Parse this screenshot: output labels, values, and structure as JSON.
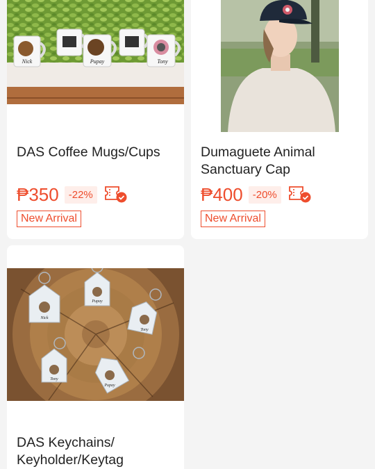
{
  "products": [
    {
      "title": "DAS Coffee Mugs/Cups",
      "price": "₱350",
      "discount": "-22%",
      "tag": "New Arrival",
      "mug_names": [
        "Nick",
        "",
        "Pupay",
        "",
        "Tony"
      ]
    },
    {
      "title_lines": [
        "Dumaguete Animal",
        "Sanctuary Cap"
      ],
      "price": "₱400",
      "discount": "-20%",
      "tag": "New Arrival"
    },
    {
      "title_lines": [
        "DAS Keychains/",
        "Keyholder/Keytag"
      ],
      "keytag_names": [
        "Nick",
        "Pupay",
        "Tony",
        "Tony",
        "Pupay"
      ]
    }
  ],
  "colors": {
    "accent": "#ee4d2d",
    "accent_bg": "#feeeea",
    "page_bg": "#f4f4f4"
  },
  "icons": [
    "voucher-check-icon"
  ]
}
